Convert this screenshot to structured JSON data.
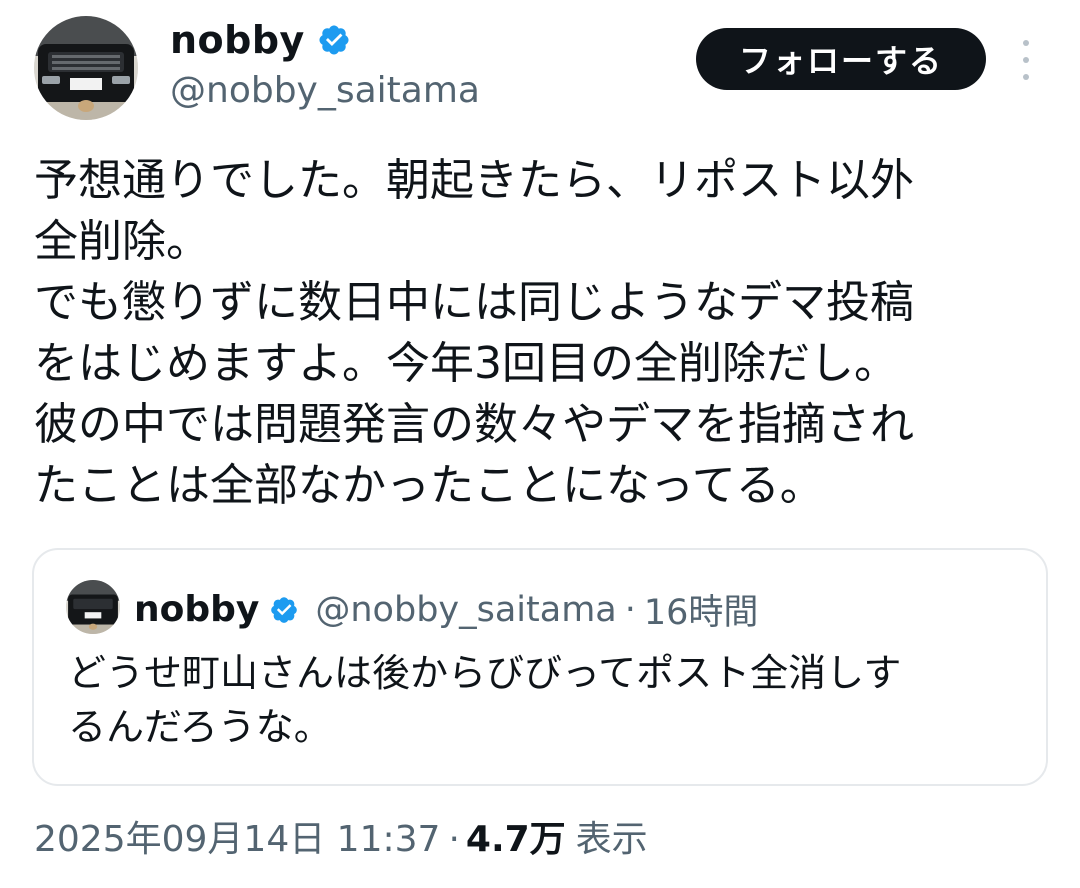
{
  "author": {
    "name": "nobby",
    "handle": "@nobby_saitama",
    "verified": true
  },
  "follow_button": {
    "label": "フォローする"
  },
  "tweet": {
    "lines": [
      "予想通りでした。朝起きたら、リポスト以外",
      "全削除。",
      "でも懲りずに数日中には同じようなデマ投稿",
      "をはじめますよ。今年3回目の全削除だし。",
      "彼の中では問題発言の数々やデマを指摘され",
      "たことは全部なかったことになってる。"
    ]
  },
  "quote": {
    "name": "nobby",
    "handle": "@nobby_saitama",
    "separator": "·",
    "time": "16時間",
    "lines": [
      "どうせ町山さんは後からびびってポスト全消しす",
      "るんだろうな。"
    ]
  },
  "meta": {
    "timestamp": "2025年09月14日 11:37",
    "separator": "·",
    "views_count": "4.7万",
    "views_label": "表示"
  },
  "colors": {
    "verified": "#1d9bf0",
    "secondary_text": "#536471",
    "follow_bg": "#0f1419"
  }
}
